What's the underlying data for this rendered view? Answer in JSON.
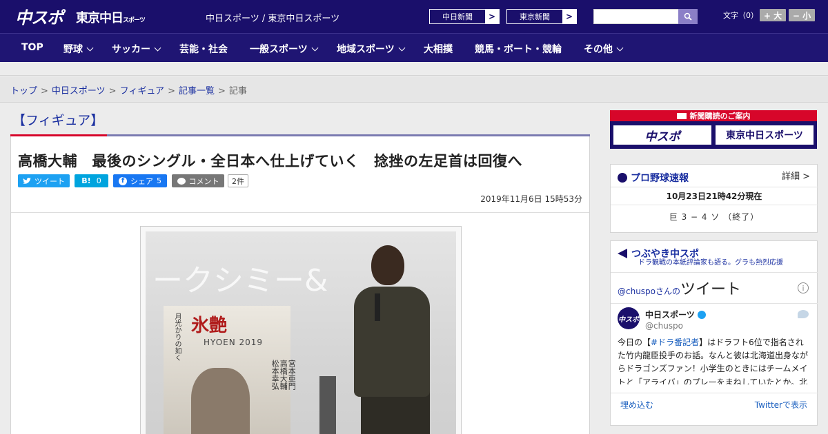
{
  "header": {
    "logo_chuspo": "中スポ",
    "logo_tokyo": "東京中日",
    "logo_tokyo_small": "スポーツ",
    "site_name": "中日スポーツ / 東京中日スポーツ",
    "paper_links": [
      "中日新聞",
      "東京新聞"
    ],
    "arrow_glyph": ">",
    "search_placeholder": "",
    "font_size_label": "文字（0）",
    "font_plus": "+ 大",
    "font_minus": "− 小"
  },
  "nav": {
    "items": [
      "TOP",
      "野球",
      "サッカー",
      "芸能・社会",
      "一般スポーツ",
      "地域スポーツ",
      "大相撲",
      "競馬・ボート・競輪",
      "その他"
    ]
  },
  "breadcrumb": {
    "items": [
      "トップ",
      "中日スポーツ",
      "フィギュア",
      "記事一覧"
    ],
    "separator": ">",
    "current": "記事"
  },
  "article": {
    "category": "【フィギュア】",
    "headline": "高橋大輔　最後のシングル・全日本へ仕上げていく　捻挫の左足首は回復へ",
    "share": {
      "tweet": "ツイート",
      "hatena_label": "B!",
      "hatena_count": "0",
      "facebook": "シェア",
      "facebook_count": "5",
      "comment": "コメント",
      "comment_count": "2件"
    },
    "date": "2019年11月6日 15時53分",
    "photo": {
      "bg_text": "ークシミー&",
      "poster_title": "氷艶",
      "poster_sub": "月光かりの如く",
      "poster_names": "宮本亜門\n高橋大輔\n松本幸弘",
      "poster_brand": "HYOEN 2019"
    }
  },
  "sidebar": {
    "subscription": {
      "title": "新聞購読のご案内",
      "logo_chuspo": "中スポ",
      "logo_tokyo": "東京中日スポーツ"
    },
    "baseball": {
      "title": "プロ野球速報",
      "detail": "詳細 >",
      "time": "10月23日21時42分現在",
      "score": "巨 3 − 4 ソ （終了）"
    },
    "twitter": {
      "title": "つぶやき中スポ",
      "subtitle": "ドラ観戦の本紙評論家も語る。グラも熱烈応援",
      "account_prefix": "@chuspoさんの",
      "account_title": "ツイート",
      "info": "i",
      "avatar_text": "中スポ",
      "user_name": "中日スポーツ",
      "user_handle": "@chuspo",
      "body_before": "今日の【",
      "body_tag": "#ドラ番記者",
      "body_after": "】はドラフト6位で指名された竹内龍臣投手のお話。なんと彼は北海道出身ながらドラゴンズファン！小学生のときにはチームメイトと「アライバ」のプレーをまねしていたとか。北国",
      "embed": "埋め込む",
      "view_on_twitter": "Twitterで表示"
    }
  },
  "colors": {
    "header_bg": "#1a0f6b",
    "nav_bg": "#1f1573",
    "accent_red": "#d7062a",
    "link_blue": "#1a2fa0",
    "twitter_blue": "#1da1f2",
    "facebook_blue": "#1877f2",
    "hatena_blue": "#00a4de"
  }
}
